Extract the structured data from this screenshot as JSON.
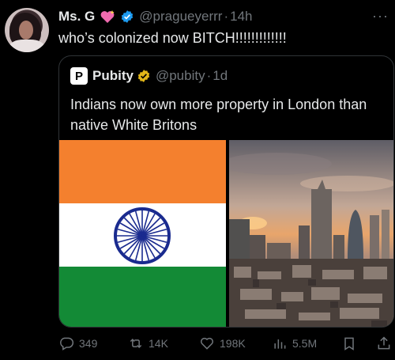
{
  "author": {
    "name": "Ms. G",
    "handle": "@pragueyerrr",
    "time": "14h"
  },
  "tweet": {
    "text": "who’s colonized now BITCH!!!!!!!!!!!!!"
  },
  "quote": {
    "avatar_letter": "P",
    "name": "Pubity",
    "handle": "@pubity",
    "time": "1d",
    "text": "Indians now own more property in London than native White Britons"
  },
  "actions": {
    "replies": "349",
    "retweets": "14K",
    "likes": "198K",
    "views": "5.5M"
  },
  "icons": {
    "heart_emoji": "sparkling-heart-icon",
    "verified": "verified-badge-icon",
    "more": "more-icon"
  },
  "colors": {
    "verified_blue": "#1d9bf0",
    "verified_gold": "#e2b719",
    "flag_saffron": "#f4802e",
    "flag_green": "#138a36",
    "chakra_blue": "#1a2b8f"
  }
}
